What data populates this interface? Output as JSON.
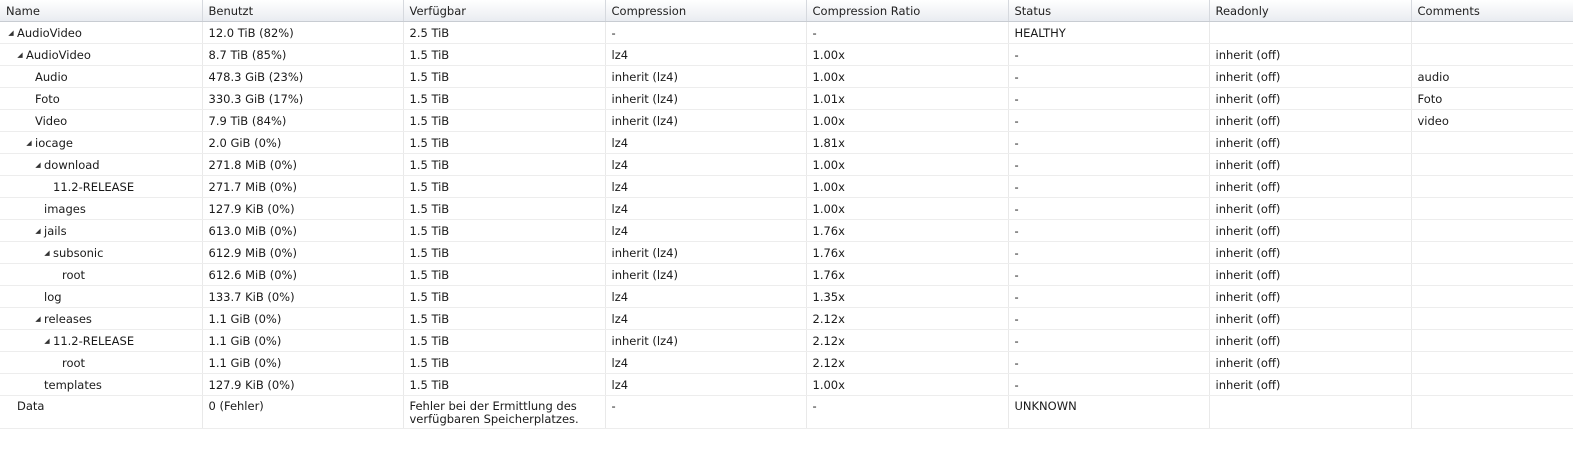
{
  "columns": [
    "Name",
    "Benutzt",
    "Verfügbar",
    "Compression",
    "Compression Ratio",
    "Status",
    "Readonly",
    "Comments"
  ],
  "rows": [
    {
      "name": "AudioVideo",
      "depth": 0,
      "expanded": true,
      "used": "12.0 TiB (82%)",
      "avail": "2.5 TiB",
      "compression": "-",
      "ratio": "-",
      "status": "HEALTHY",
      "readonly": "",
      "comments": ""
    },
    {
      "name": "AudioVideo",
      "depth": 1,
      "expanded": true,
      "used": "8.7 TiB (85%)",
      "avail": "1.5 TiB",
      "compression": "lz4",
      "ratio": "1.00x",
      "status": "-",
      "readonly": "inherit (off)",
      "comments": ""
    },
    {
      "name": "Audio",
      "depth": 2,
      "expanded": null,
      "used": "478.3 GiB (23%)",
      "avail": "1.5 TiB",
      "compression": "inherit (lz4)",
      "ratio": "1.00x",
      "status": "-",
      "readonly": "inherit (off)",
      "comments": "audio"
    },
    {
      "name": "Foto",
      "depth": 2,
      "expanded": null,
      "used": "330.3 GiB (17%)",
      "avail": "1.5 TiB",
      "compression": "inherit (lz4)",
      "ratio": "1.01x",
      "status": "-",
      "readonly": "inherit (off)",
      "comments": "Foto"
    },
    {
      "name": "Video",
      "depth": 2,
      "expanded": null,
      "used": "7.9 TiB (84%)",
      "avail": "1.5 TiB",
      "compression": "inherit (lz4)",
      "ratio": "1.00x",
      "status": "-",
      "readonly": "inherit (off)",
      "comments": "video"
    },
    {
      "name": "iocage",
      "depth": 2,
      "expanded": true,
      "used": "2.0 GiB (0%)",
      "avail": "1.5 TiB",
      "compression": "lz4",
      "ratio": "1.81x",
      "status": "-",
      "readonly": "inherit (off)",
      "comments": ""
    },
    {
      "name": "download",
      "depth": 3,
      "expanded": true,
      "used": "271.8 MiB (0%)",
      "avail": "1.5 TiB",
      "compression": "lz4",
      "ratio": "1.00x",
      "status": "-",
      "readonly": "inherit (off)",
      "comments": ""
    },
    {
      "name": "11.2-RELEASE",
      "depth": 4,
      "expanded": null,
      "used": "271.7 MiB (0%)",
      "avail": "1.5 TiB",
      "compression": "lz4",
      "ratio": "1.00x",
      "status": "-",
      "readonly": "inherit (off)",
      "comments": ""
    },
    {
      "name": "images",
      "depth": 3,
      "expanded": null,
      "used": "127.9 KiB (0%)",
      "avail": "1.5 TiB",
      "compression": "lz4",
      "ratio": "1.00x",
      "status": "-",
      "readonly": "inherit (off)",
      "comments": ""
    },
    {
      "name": "jails",
      "depth": 3,
      "expanded": true,
      "used": "613.0 MiB (0%)",
      "avail": "1.5 TiB",
      "compression": "lz4",
      "ratio": "1.76x",
      "status": "-",
      "readonly": "inherit (off)",
      "comments": ""
    },
    {
      "name": "subsonic",
      "depth": 4,
      "expanded": true,
      "used": "612.9 MiB (0%)",
      "avail": "1.5 TiB",
      "compression": "inherit (lz4)",
      "ratio": "1.76x",
      "status": "-",
      "readonly": "inherit (off)",
      "comments": ""
    },
    {
      "name": "root",
      "depth": 5,
      "expanded": null,
      "used": "612.6 MiB (0%)",
      "avail": "1.5 TiB",
      "compression": "inherit (lz4)",
      "ratio": "1.76x",
      "status": "-",
      "readonly": "inherit (off)",
      "comments": ""
    },
    {
      "name": "log",
      "depth": 3,
      "expanded": null,
      "used": "133.7 KiB (0%)",
      "avail": "1.5 TiB",
      "compression": "lz4",
      "ratio": "1.35x",
      "status": "-",
      "readonly": "inherit (off)",
      "comments": ""
    },
    {
      "name": "releases",
      "depth": 3,
      "expanded": true,
      "used": "1.1 GiB (0%)",
      "avail": "1.5 TiB",
      "compression": "lz4",
      "ratio": "2.12x",
      "status": "-",
      "readonly": "inherit (off)",
      "comments": ""
    },
    {
      "name": "11.2-RELEASE",
      "depth": 4,
      "expanded": true,
      "used": "1.1 GiB (0%)",
      "avail": "1.5 TiB",
      "compression": "inherit (lz4)",
      "ratio": "2.12x",
      "status": "-",
      "readonly": "inherit (off)",
      "comments": ""
    },
    {
      "name": "root",
      "depth": 5,
      "expanded": null,
      "used": "1.1 GiB (0%)",
      "avail": "1.5 TiB",
      "compression": "lz4",
      "ratio": "2.12x",
      "status": "-",
      "readonly": "inherit (off)",
      "comments": ""
    },
    {
      "name": "templates",
      "depth": 3,
      "expanded": null,
      "used": "127.9 KiB (0%)",
      "avail": "1.5 TiB",
      "compression": "lz4",
      "ratio": "1.00x",
      "status": "-",
      "readonly": "inherit (off)",
      "comments": ""
    },
    {
      "name": "Data",
      "depth": 0,
      "expanded": null,
      "used": "0 (Fehler)",
      "avail": "Fehler bei der Ermittlung des verfügbaren Speicherplatzes.",
      "compression": "-",
      "ratio": "-",
      "status": "UNKNOWN",
      "readonly": "",
      "comments": ""
    }
  ]
}
